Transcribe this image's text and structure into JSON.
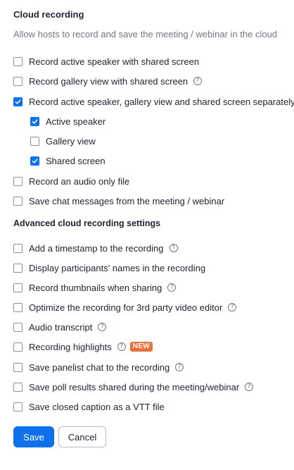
{
  "heading": "Cloud recording",
  "description": "Allow hosts to record and save the meeting / webinar in the cloud",
  "options": [
    {
      "label": "Record active speaker with shared screen",
      "checked": false,
      "help": false
    },
    {
      "label": "Record gallery view with shared screen",
      "checked": false,
      "help": true
    },
    {
      "label": "Record active speaker, gallery view and shared screen separately",
      "checked": true,
      "help": false
    },
    {
      "label": "Active speaker",
      "checked": true,
      "help": false
    },
    {
      "label": "Gallery view",
      "checked": false,
      "help": false
    },
    {
      "label": "Shared screen",
      "checked": true,
      "help": false
    },
    {
      "label": "Record an audio only file",
      "checked": false,
      "help": false
    },
    {
      "label": "Save chat messages from the meeting / webinar",
      "checked": false,
      "help": false
    }
  ],
  "advanced": {
    "heading": "Advanced cloud recording settings",
    "options": [
      {
        "label": "Add a timestamp to the recording",
        "checked": false,
        "help": true
      },
      {
        "label": "Display participants' names in the recording",
        "checked": false,
        "help": false
      },
      {
        "label": "Record thumbnails when sharing",
        "checked": false,
        "help": true
      },
      {
        "label": "Optimize the recording for 3rd party video editor",
        "checked": false,
        "help": true
      },
      {
        "label": "Audio transcript",
        "checked": false,
        "help": true
      },
      {
        "label": "Recording highlights",
        "checked": false,
        "help": true,
        "badge": "NEW"
      },
      {
        "label": "Save panelist chat to the recording",
        "checked": false,
        "help": true
      },
      {
        "label": "Save poll results shared during the meeting/webinar",
        "checked": false,
        "help": true
      },
      {
        "label": "Save closed caption as a VTT file",
        "checked": false,
        "help": false
      }
    ]
  },
  "help_glyph": "?",
  "buttons": {
    "save": "Save",
    "cancel": "Cancel"
  },
  "colors": {
    "accent": "#0e71eb",
    "badge": "#e8713c"
  },
  "icons": {
    "check": "check-icon",
    "help": "help-circle-icon"
  }
}
